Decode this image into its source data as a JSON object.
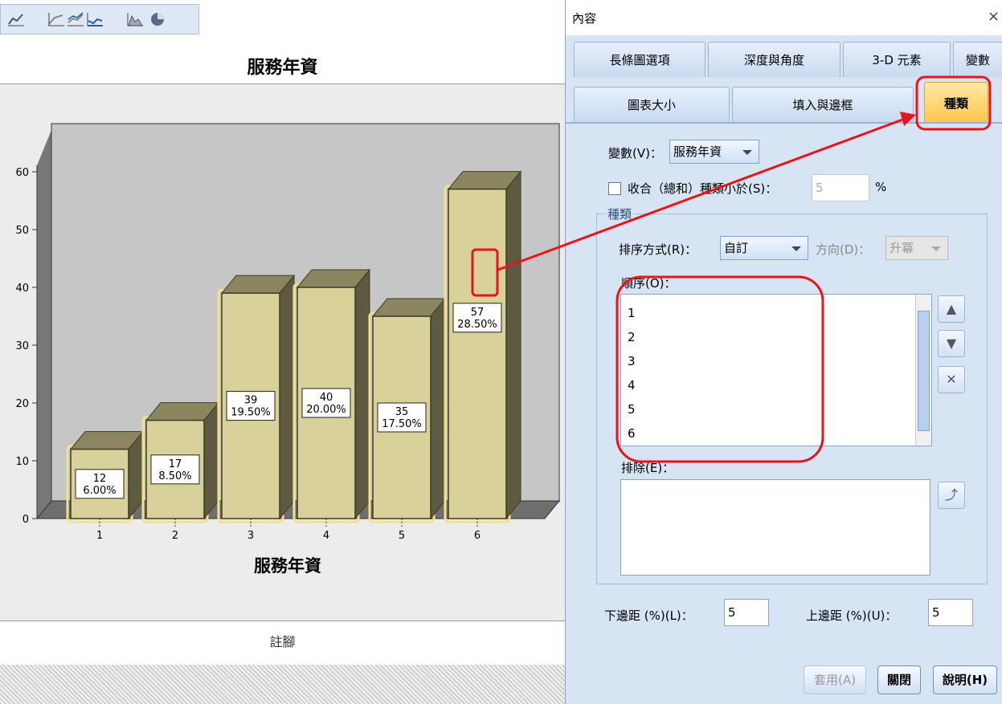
{
  "chart_data": {
    "type": "bar",
    "title": "服務年資",
    "xlabel": "服務年資",
    "ylabel": "",
    "categories": [
      "1",
      "2",
      "3",
      "4",
      "5",
      "6"
    ],
    "values": [
      12,
      17,
      39,
      40,
      35,
      57
    ],
    "labels": [
      "12",
      "17",
      "39",
      "40",
      "35",
      "57"
    ],
    "percents": [
      "6.00%",
      "8.50%",
      "19.50%",
      "20.00%",
      "17.50%",
      "28.50%"
    ],
    "ylim": [
      0,
      60
    ],
    "yticks": [
      "0",
      "10",
      "20",
      "30",
      "40",
      "50",
      "60"
    ],
    "bar_color": "#d8d29a",
    "bar_side_color": "#8b8660",
    "highlight_color": "#f5e08a",
    "style": "3d"
  },
  "footnote": "註腳",
  "dialog": {
    "title": "內容",
    "close": "×",
    "tabs_row1": [
      "長條圖選項",
      "深度與角度",
      "3-D 元素",
      "變數"
    ],
    "tabs_row2": [
      "圖表大小",
      "填入與邊框",
      "種類"
    ],
    "variable_label": "變數(V)：",
    "variable_value": "服務年資",
    "collapse_label": "收合（總和）種類小於(S)：",
    "collapse_value": "5",
    "collapse_unit": "%",
    "group_label": "種類",
    "sort_label": "排序方式(R)：",
    "sort_value": "自訂",
    "direction_label": "方向(D)：",
    "direction_value": "升冪",
    "order_label": "順序(O)：",
    "order_items": [
      "1",
      "2",
      "3",
      "4",
      "5",
      "6"
    ],
    "excluded_label": "排除(E)：",
    "lower_margin_label": "下邊距 (%)(L)：",
    "lower_margin_value": "5",
    "upper_margin_label": "上邊距 (%)(U)：",
    "upper_margin_value": "5",
    "apply": "套用(A)",
    "close_btn": "關閉",
    "help": "說明(H)"
  },
  "colors": {
    "annotation": "#e8141a",
    "active_tab": "#ffc548",
    "dialog_bg": "#d6e4f3"
  }
}
